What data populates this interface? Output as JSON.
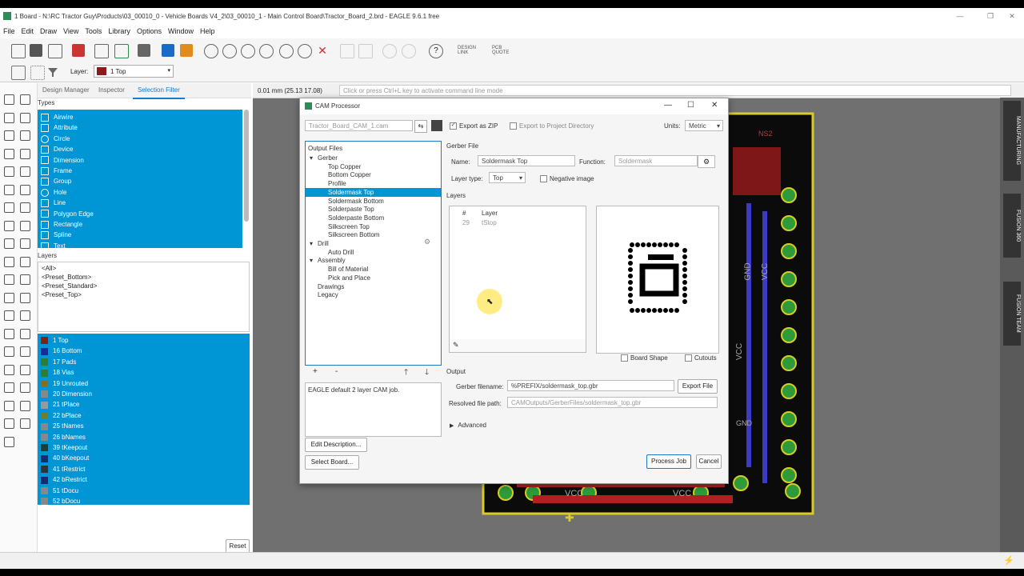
{
  "window": {
    "title": "1 Board - N:\\RC Tractor Guy\\Products\\03_00010_0 - Vehicle Boards V4_2\\03_00010_1 - Main Control Board\\Tractor_Board_2.brd - EAGLE 9.6.1 free"
  },
  "menu": [
    "File",
    "Edit",
    "Draw",
    "View",
    "Tools",
    "Library",
    "Options",
    "Window",
    "Help"
  ],
  "toolbar": {
    "design_link": "DESIGN LINK",
    "pcb_quote": "PCB QUOTE",
    "layer_label": "Layer:",
    "layer_value": "1 Top",
    "layer_color": "#8b1a1a"
  },
  "panel": {
    "tabs": [
      "Design Manager",
      "Inspector",
      "Selection Filter"
    ],
    "types_label": "Types",
    "types": [
      "Airwire",
      "Attribute",
      "Circle",
      "Device",
      "Dimension",
      "Frame",
      "Group",
      "Hole",
      "Line",
      "Polygon Edge",
      "Rectangle",
      "Spline",
      "Text"
    ],
    "layers_label": "Layers",
    "presets": [
      "<All>",
      "<Preset_Bottom>",
      "<Preset_Standard>",
      "<Preset_Top>"
    ],
    "layers": [
      {
        "name": "1 Top",
        "color": "#8b1a1a"
      },
      {
        "name": "16 Bottom",
        "color": "#1a2a9b"
      },
      {
        "name": "17 Pads",
        "color": "#2e7d32"
      },
      {
        "name": "18 Vias",
        "color": "#2e7d32"
      },
      {
        "name": "19 Unrouted",
        "color": "#8a6d1a"
      },
      {
        "name": "20 Dimension",
        "color": "#888888"
      },
      {
        "name": "21 tPlace",
        "color": "#999999"
      },
      {
        "name": "22 bPlace",
        "color": "#7a7a2a"
      },
      {
        "name": "25 tNames",
        "color": "#888888"
      },
      {
        "name": "26 bNames",
        "color": "#888888"
      },
      {
        "name": "39 tKeepout",
        "color": "#333333"
      },
      {
        "name": "40 bKeepout",
        "color": "#1a2a6b"
      },
      {
        "name": "41 tRestrict",
        "color": "#333333"
      },
      {
        "name": "42 bRestrict",
        "color": "#1a2a6b"
      },
      {
        "name": "51 tDocu",
        "color": "#888888"
      },
      {
        "name": "52 bDocu",
        "color": "#888888"
      }
    ],
    "reset": "Reset"
  },
  "canvas": {
    "coord": "0.01 mm (25.13 17.08)",
    "command_placeholder": "Click or press Ctrl+L key to activate command line mode"
  },
  "right_strip": [
    "MANUFACTURING",
    "FUSION 360",
    "FUSION TEAM"
  ],
  "cam": {
    "title": "CAM Processor",
    "job_file": "Tractor_Board_CAM_1.cam",
    "export_zip": "Export as ZIP",
    "export_dir": "Export to Project Directory",
    "units_label": "Units:",
    "units_value": "Metric",
    "output_files_label": "Output Files",
    "tree": [
      {
        "label": "Gerber",
        "level": 0,
        "expander": "▾"
      },
      {
        "label": "Top Copper",
        "level": 1
      },
      {
        "label": "Bottom Copper",
        "level": 1
      },
      {
        "label": "Profile",
        "level": 1
      },
      {
        "label": "Soldermask Top",
        "level": 1,
        "selected": true
      },
      {
        "label": "Soldermask Bottom",
        "level": 1
      },
      {
        "label": "Solderpaste Top",
        "level": 1
      },
      {
        "label": "Solderpaste Bottom",
        "level": 1
      },
      {
        "label": "Silkscreen Top",
        "level": 1
      },
      {
        "label": "Silkscreen Bottom",
        "level": 1
      },
      {
        "label": "Drill",
        "level": 0,
        "expander": "▾"
      },
      {
        "label": "Auto Drill",
        "level": 1
      },
      {
        "label": "Assembly",
        "level": 0,
        "expander": "▾"
      },
      {
        "label": "Bill of Material",
        "level": 1
      },
      {
        "label": "Pick and Place",
        "level": 1
      },
      {
        "label": "Drawings",
        "level": 0
      },
      {
        "label": "Legacy",
        "level": 0
      }
    ],
    "tree_add": "+",
    "tree_remove": "-",
    "description": "EAGLE default 2 layer CAM job.",
    "edit_description": "Edit Description...",
    "select_board": "Select Board...",
    "gerber_file_label": "Gerber File",
    "name_label": "Name:",
    "name_value": "Soldermask Top",
    "function_label": "Function:",
    "function_value": "Soldermask",
    "layer_type_label": "Layer type:",
    "layer_type_value": "Top",
    "negative_image": "Negative image",
    "layers_label": "Layers",
    "layers_header": [
      "#",
      "Layer"
    ],
    "layers_rows": [
      [
        "29",
        "tStop"
      ]
    ],
    "board_shape": "Board Shape",
    "cutouts": "Cutouts",
    "output_label": "Output",
    "gerber_filename_label": "Gerber filename:",
    "gerber_filename_value": "%PREFIX/soldermask_top.gbr",
    "export_file": "Export File",
    "resolved_label": "Resolved file path:",
    "resolved_value": "CAMOutputs/GerberFiles/soldermask_top.gbr",
    "advanced": "Advanced",
    "process_job": "Process Job",
    "cancel": "Cancel"
  },
  "pcb_labels": [
    "NS2",
    "GND",
    "VCC",
    "VCC",
    "VCC",
    "VCC",
    "GND"
  ]
}
